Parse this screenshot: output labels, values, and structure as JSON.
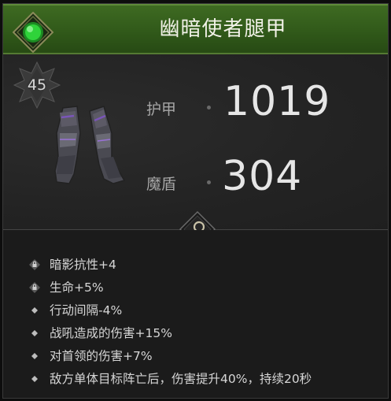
{
  "item": {
    "name": "幽暗使者腿甲",
    "level": "45",
    "image_icon": "armored-legs-icon",
    "rarity_icon": "green-gem-icon"
  },
  "stats": [
    {
      "label": "护甲",
      "value": "1019"
    },
    {
      "label": "魔盾",
      "value": "304"
    }
  ],
  "inspect_icon": "magnifier-icon",
  "affixes": [
    {
      "icon": "lock-icon",
      "text": "暗影抗性+4"
    },
    {
      "icon": "lock-icon",
      "text": "生命+5%"
    },
    {
      "icon": "diamond-icon",
      "text": "行动间隔-4%"
    },
    {
      "icon": "diamond-icon",
      "text": "战吼造成的伤害+15%"
    },
    {
      "icon": "diamond-icon",
      "text": "对首领的伤害+7%"
    },
    {
      "icon": "diamond-icon",
      "text": "敌方单体目标阵亡后，伤害提升40%，持续20秒"
    }
  ],
  "colors": {
    "header_green": "#315a1a",
    "gem_green": "#2fd33a",
    "panel_bg": "#1e1e1e",
    "text_main": "#e6e6e6",
    "text_muted": "#a6a6a6"
  }
}
